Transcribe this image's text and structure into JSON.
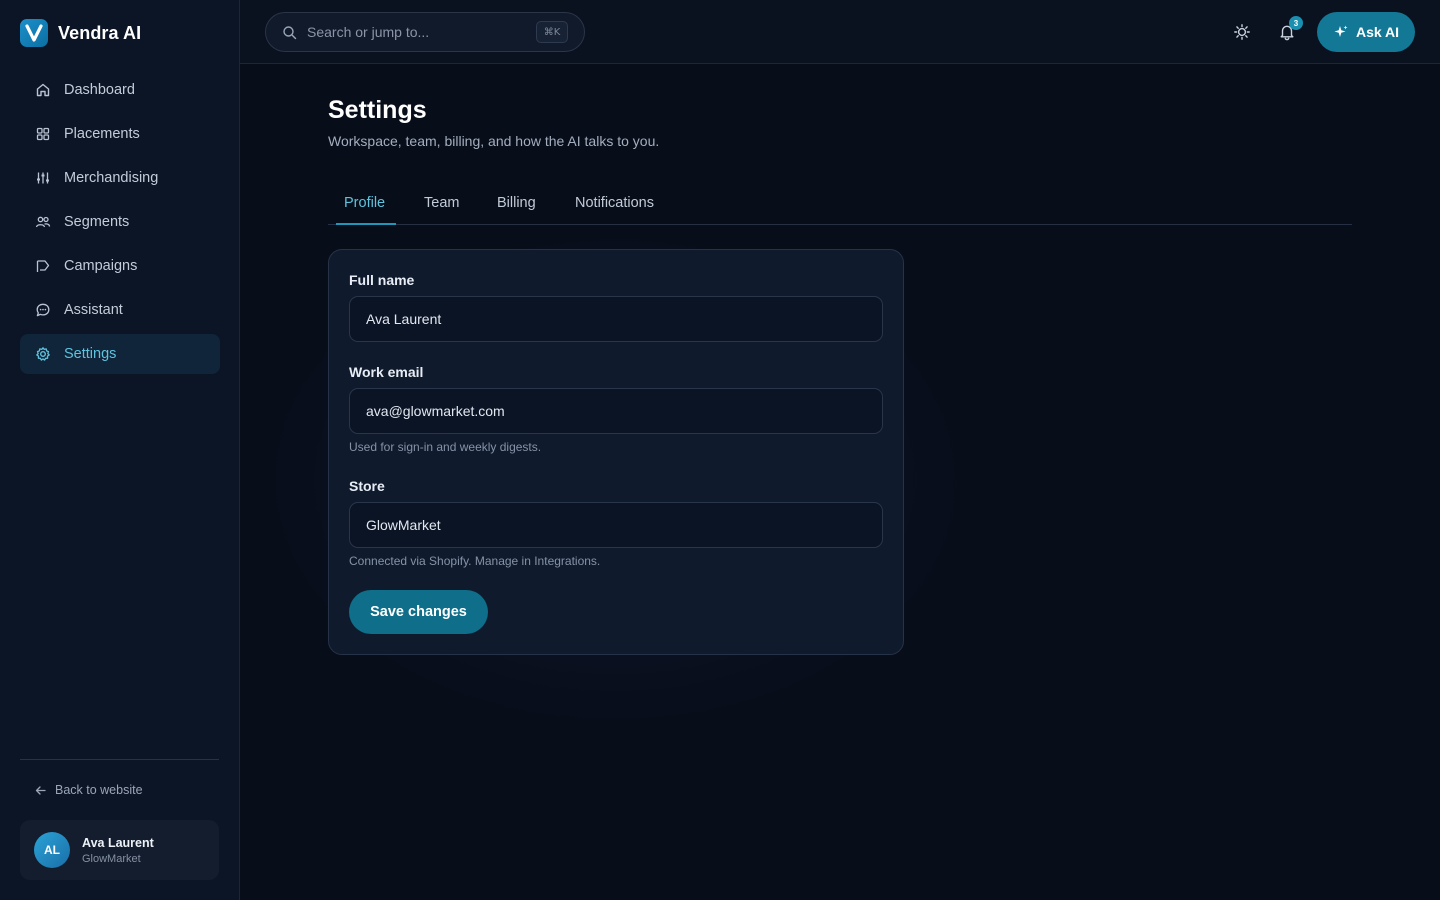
{
  "brand": {
    "name": "Vendra AI",
    "logo_letter": "V"
  },
  "sidebar": {
    "items": [
      {
        "label": "Dashboard",
        "icon": "home-icon"
      },
      {
        "label": "Placements",
        "icon": "grid-icon"
      },
      {
        "label": "Merchandising",
        "icon": "sliders-icon"
      },
      {
        "label": "Segments",
        "icon": "users-icon"
      },
      {
        "label": "Campaigns",
        "icon": "flag-icon"
      },
      {
        "label": "Assistant",
        "icon": "chat-icon"
      },
      {
        "label": "Settings",
        "icon": "gear-icon",
        "active": true
      }
    ],
    "back_link": "Back to website",
    "user": {
      "initials": "AL",
      "name": "Ava Laurent",
      "store": "GlowMarket"
    }
  },
  "topbar": {
    "search_placeholder": "Search or jump to...",
    "search_shortcut": "⌘K",
    "notification_count": "3",
    "ask_label": "Ask AI"
  },
  "page": {
    "title": "Settings",
    "subtitle": "Workspace, team, billing, and how the AI talks to you.",
    "tabs": [
      {
        "label": "Profile",
        "active": true
      },
      {
        "label": "Team"
      },
      {
        "label": "Billing"
      },
      {
        "label": "Notifications"
      }
    ]
  },
  "form": {
    "full_name": {
      "label": "Full name",
      "value": "Ava Laurent"
    },
    "work_email": {
      "label": "Work email",
      "value": "ava@glowmarket.com",
      "help": "Used for sign-in and weekly digests."
    },
    "store": {
      "label": "Store",
      "value": "GlowMarket",
      "help": "Connected via Shopify. Manage in Integrations."
    },
    "save_label": "Save changes"
  },
  "colors": {
    "accent": "#1f97b8",
    "accent_text": "#5fc3dd",
    "background": "#080d1a",
    "sidebar_bg": "#0c1526",
    "button_bg": "#0f6e89"
  }
}
